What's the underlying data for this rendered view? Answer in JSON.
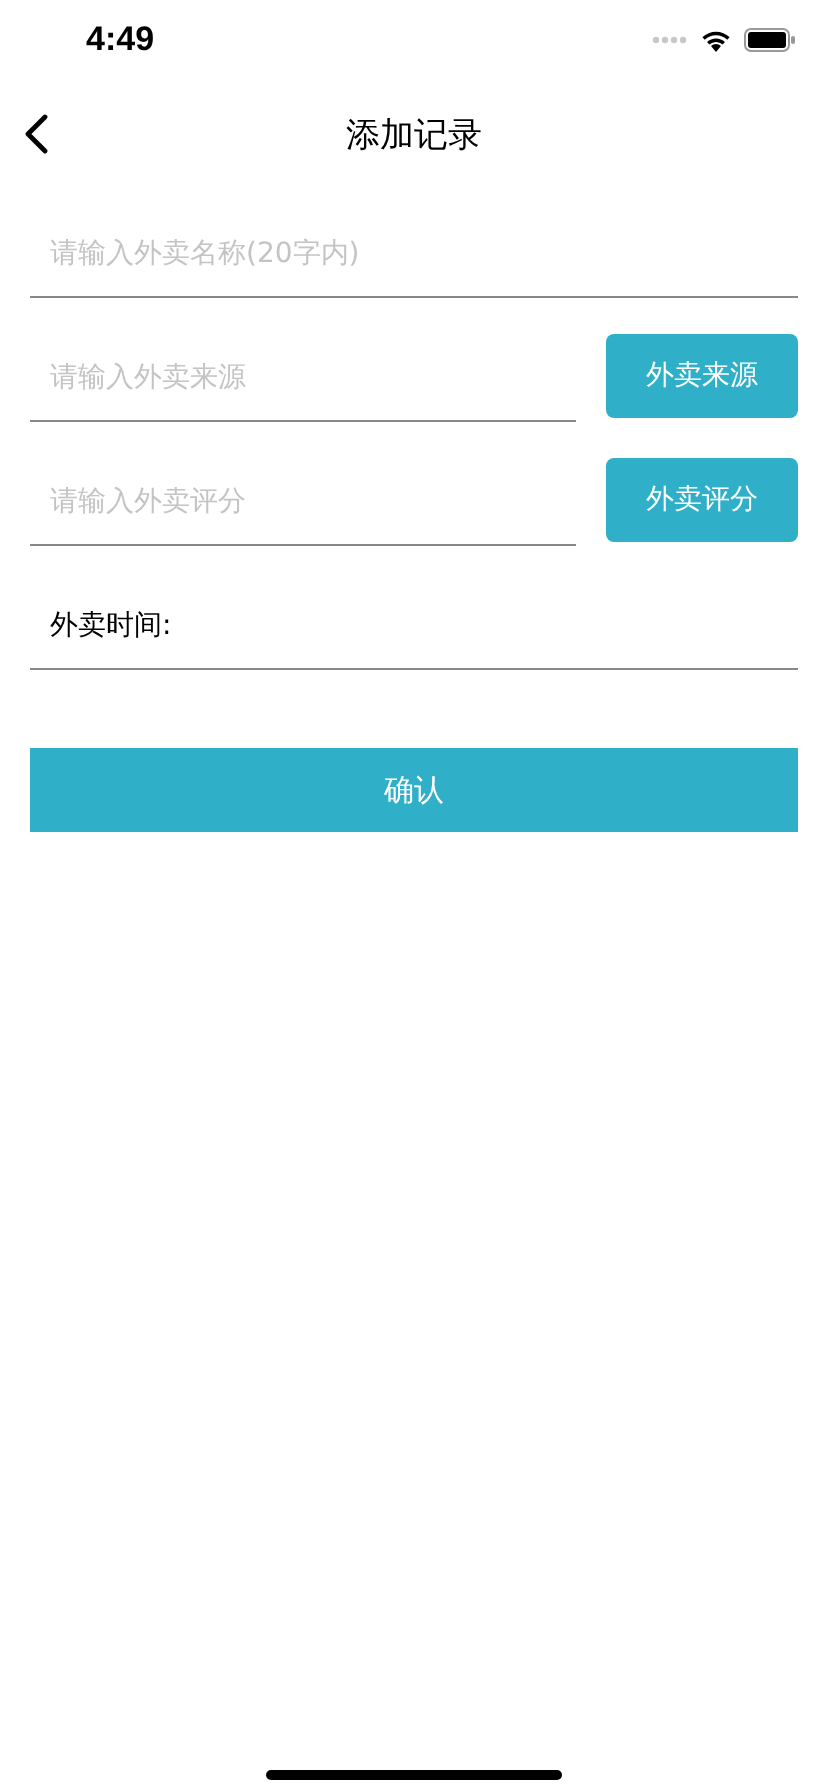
{
  "status_bar": {
    "time": "4:49"
  },
  "nav": {
    "title": "添加记录"
  },
  "fields": [
    {
      "kind": "input",
      "placeholder": "请输入外卖名称(20字内)"
    },
    {
      "kind": "input_button",
      "placeholder": "请输入外卖来源",
      "button": "外卖来源"
    },
    {
      "kind": "input_button",
      "placeholder": "请输入外卖评分",
      "button": "外卖评分"
    },
    {
      "kind": "label",
      "label": "外卖时间:"
    }
  ],
  "confirm_button": "确认"
}
